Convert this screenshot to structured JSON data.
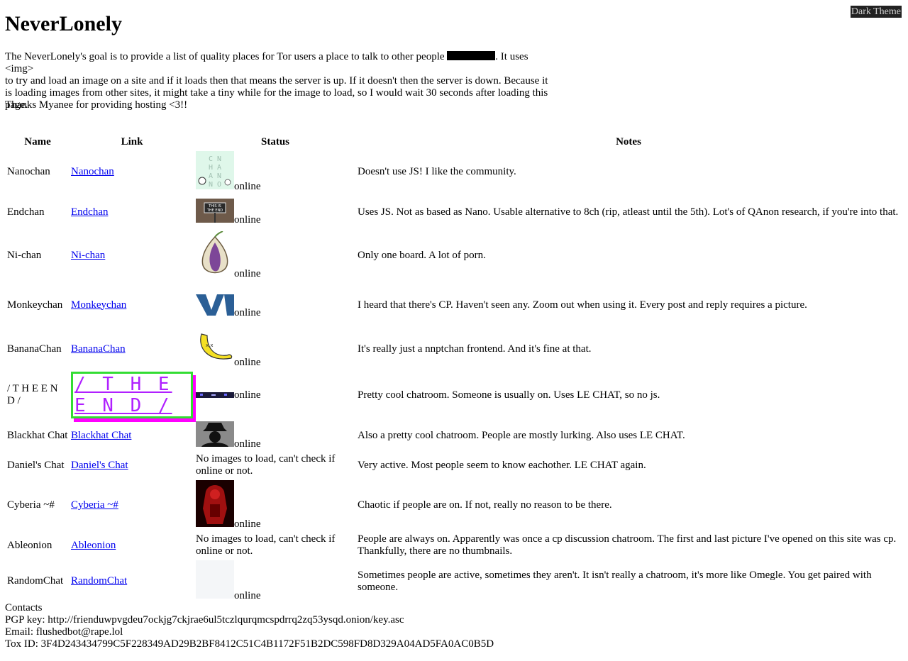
{
  "theme_button": "Dark Theme",
  "title": "NeverLonely",
  "intro": {
    "part1": "The NeverLonely's goal is to provide a list of quality places for Tor users a place to talk to other people ",
    "part2": ". It uses <img>",
    "line2": "to try and load an image on a site and if it loads then that means the server is up. If it doesn't then the server is down. Because it",
    "line3": "is loading images from other sites, it might take a tiny while for the image to load, so I would wait 30 seconds after loading this page."
  },
  "thanks": "Thanks Myanee for providing hosting <3!!",
  "table": {
    "headers": [
      "Name",
      "Link",
      "Status",
      "Notes"
    ],
    "rows": [
      {
        "name": "Nanochan",
        "link": "Nanochan",
        "status": "online",
        "notes": "Doesn't use JS! I like the community."
      },
      {
        "name": "Endchan",
        "link": "Endchan",
        "status": "online",
        "notes": "Uses JS. Not as based as Nano. Usable alternative to 8ch (rip, atleast until the 5th). Lot's of QAnon research, if you're into that."
      },
      {
        "name": "Ni-chan",
        "link": "Ni-chan",
        "status": "online",
        "notes": "Only one board. A lot of porn."
      },
      {
        "name": "Monkeychan",
        "link": "Monkeychan",
        "status": "online",
        "notes": "I heard that there's CP. Haven't seen any. Zoom out when using it. Every post and reply requires a picture."
      },
      {
        "name": "BananaChan",
        "link": "BananaChan",
        "status": "online",
        "notes": "It's really just a nnptchan frontend. And it's fine at that."
      },
      {
        "name": "/ T H E E N D /",
        "link": "/ T H E E N D /",
        "status": "online",
        "notes": "Pretty cool chatroom. Someone is usually on. Uses LE CHAT, so no js."
      },
      {
        "name": "Blackhat Chat",
        "link": "Blackhat Chat",
        "status": "online",
        "notes": "Also a pretty cool chatroom. People are mostly lurking. Also uses LE CHAT."
      },
      {
        "name": "Daniel's Chat",
        "link": "Daniel's Chat",
        "status": "No images to load, can't check if online or not.",
        "notes": "Very active. Most people seem to know eachother. LE CHAT again."
      },
      {
        "name": "Cyberia ~#",
        "link": "Cyberia ~#",
        "status": "online",
        "notes": "Chaotic if people are on. If not, really no reason to be there."
      },
      {
        "name": "Ableonion",
        "link": "Ableonion",
        "status": "No images to load, can't check if online or not.",
        "notes": "People are always on. Apparently was once a cp discussion chatroom. The first and last picture I've opened on this site was cp. Thankfully, there are no thumbnails."
      },
      {
        "name": "RandomChat",
        "link": "RandomChat",
        "status": "online",
        "notes": "Sometimes people are active, sometimes they aren't. It isn't really a chatroom, it's more like Omegle. You get paired with someone."
      }
    ]
  },
  "contacts": {
    "heading": "Contacts",
    "pgp": "PGP key: http://frienduwpvgdeu7ockjg7ckjrae6ul5tczlqurqmcspdrrq2zq53ysqd.onion/key.asc",
    "email": "Email: flushedbot@rape.lol",
    "tox": "Tox ID: 3F4D243434799C5F228349AD29B2BF8412C51C4B1172F51B2DC598FD8D329A04AD5FA0AC0B5D"
  }
}
